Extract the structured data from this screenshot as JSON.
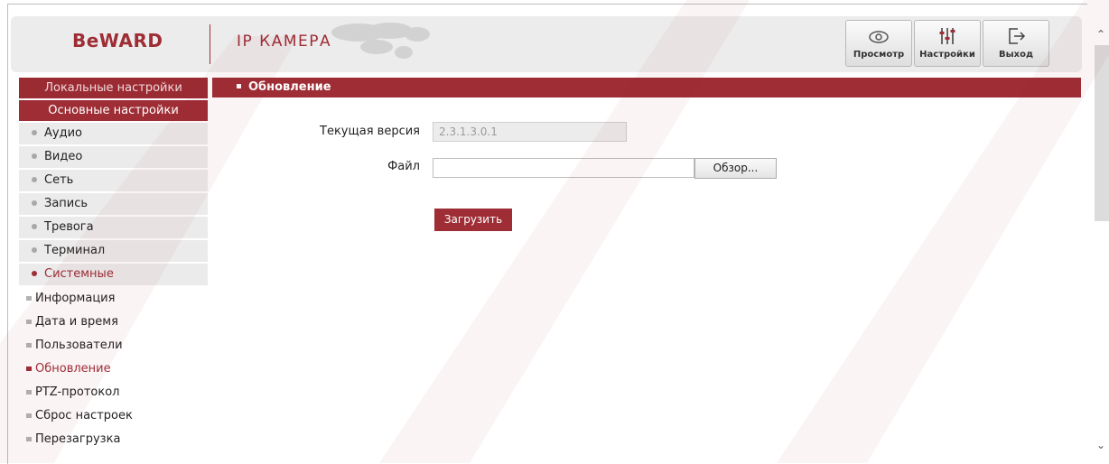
{
  "header": {
    "logo_text": "BeWARD",
    "product_title": "IP КАМЕРА",
    "buttons": {
      "view": "Просмотр",
      "settings": "Настройки",
      "exit": "Выход"
    }
  },
  "sidebar": {
    "local": "Локальные настройки",
    "main": "Основные настройки",
    "items": [
      {
        "label": "Аудио"
      },
      {
        "label": "Видео"
      },
      {
        "label": "Сеть"
      },
      {
        "label": "Запись"
      },
      {
        "label": "Тревога"
      },
      {
        "label": "Терминал"
      },
      {
        "label": "Системные"
      }
    ],
    "subitems": [
      {
        "label": "Информация"
      },
      {
        "label": "Дата и время"
      },
      {
        "label": "Пользователи"
      },
      {
        "label": "Обновление"
      },
      {
        "label": "PTZ-протокол"
      },
      {
        "label": "Сброс настроек"
      },
      {
        "label": "Перезагрузка"
      }
    ]
  },
  "content": {
    "section_title": "Обновление",
    "current_version_label": "Текущая версия",
    "current_version_value": "2.3.1.3.0.1",
    "file_label": "Файл",
    "file_value": "",
    "browse_label": "Обзор...",
    "upload_label": "Загрузить"
  },
  "colors": {
    "accent": "#9e2d35",
    "panel": "#ececec"
  }
}
